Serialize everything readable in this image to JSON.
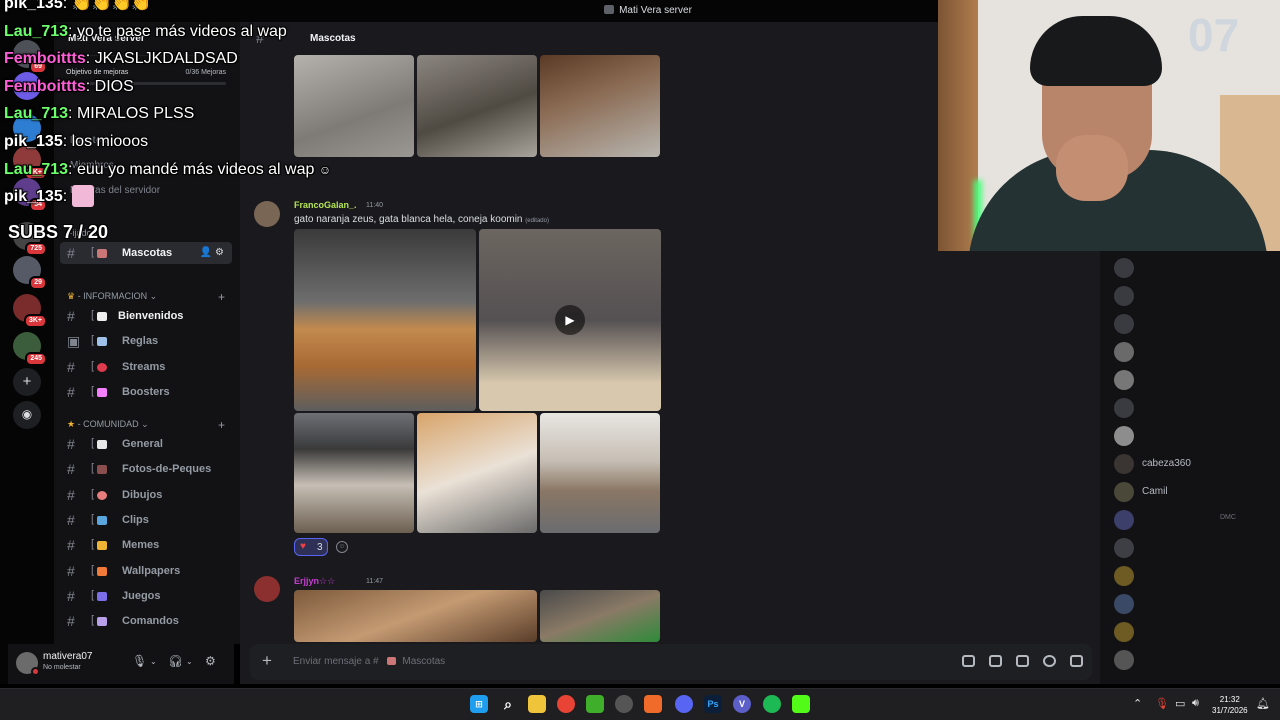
{
  "window": {
    "title": "Mati Vera server"
  },
  "servers": {
    "badges": [
      "69",
      "6K+",
      "34",
      "725",
      "29",
      "3K+",
      "245"
    ],
    "add_icon": "plus-icon",
    "explore_icon": "compass-icon"
  },
  "sidebar": {
    "server_name": "Mati Vera server",
    "boost_goal_label": "Objetivo de mejoras",
    "boost_goal_value": "0/36 Mejoras",
    "boost_progress": 0,
    "links": [
      "Eventos",
      "Miembros",
      "Mejoras del servidor"
    ],
    "categories": {
      "fixed": "Fijados",
      "info": "INFORMACION",
      "community": "COMUNIDAD"
    },
    "pinned_channels": [
      {
        "label": "Mascotas",
        "emoji_color": "#c77",
        "active": true
      }
    ],
    "info_channels": [
      {
        "label": "Bienvenidos",
        "emoji_color": "#eee",
        "white": true
      },
      {
        "label": "Reglas",
        "emoji_color": "#9fc0e8"
      },
      {
        "label": "Streams",
        "emoji_color": "#e03a4f"
      },
      {
        "label": "Boosters",
        "emoji_color": "#f47fff"
      }
    ],
    "community_channels": [
      {
        "label": "General",
        "emoji_color": "#e8e8e8"
      },
      {
        "label": "Fotos-de-Peques",
        "emoji_color": "#8a4e4e"
      },
      {
        "label": "Dibujos",
        "emoji_color": "#e67c7c"
      },
      {
        "label": "Clips",
        "emoji_color": "#5aa7e0"
      },
      {
        "label": "Memes",
        "emoji_color": "#f0b232"
      },
      {
        "label": "Wallpapers",
        "emoji_color": "#f07a3a"
      },
      {
        "label": "Juegos",
        "emoji_color": "#7b6ee8"
      },
      {
        "label": "Comandos",
        "emoji_color": "#b9a0e8"
      }
    ]
  },
  "user": {
    "name": "mativera07",
    "status": "No molestar"
  },
  "channel": {
    "name": "Mascotas",
    "composer_placeholder": "Enviar mensaje a # ",
    "composer_channel": "Mascotas"
  },
  "messages": [
    {
      "author": "FrancoGalan_.",
      "author_color": "#b5e655",
      "time": "11:40",
      "text": "gato naranja zeus, gata blanca hela, coneja koomin",
      "edited": "(editado)",
      "reaction_count": "3"
    },
    {
      "author": "Erjjyn☆☆",
      "author_color": "#c43dd1",
      "time": "11:47"
    }
  ],
  "members": [
    {
      "name": "",
      "lit": false
    },
    {
      "name": "",
      "lit": false
    },
    {
      "name": "",
      "lit": false
    },
    {
      "name": "",
      "lit": false
    },
    {
      "name": "",
      "lit": false
    },
    {
      "name": "",
      "lit": false
    },
    {
      "name": "",
      "lit": false
    },
    {
      "name": "cabeza360",
      "lit": true
    },
    {
      "name": "Camil",
      "lit": true
    }
  ],
  "member_tag": "DMC",
  "overlay": {
    "chat": [
      {
        "user": "pik_135",
        "color": "#ffffff",
        "text": ""
      },
      {
        "user": "Lau_713",
        "color": "#6bff6b",
        "text": "yo te pase más videos al wap"
      },
      {
        "user": "Femboittts",
        "color": "#ff5ed7",
        "text": "JKASLJKDALDSAD"
      },
      {
        "user": "Femboittts",
        "color": "#ff5ed7",
        "text": "DIOS"
      },
      {
        "user": "Lau_713",
        "color": "#6bff6b",
        "text": "MIRALOS PLSS"
      },
      {
        "user": "pik_135",
        "color": "#ffffff",
        "text": "los miooos"
      },
      {
        "user": "Lau_713",
        "color": "#6bff6b",
        "text": "euu yo mandé más videos al wap"
      },
      {
        "user": "pik_135",
        "color": "#ffffff",
        "text": ""
      }
    ],
    "subs": "SUBS 7 / 20"
  },
  "taskbar": {
    "time": "21:32",
    "date": "31/7/2026"
  },
  "colors": {
    "discord_bg": "#1a1a1e",
    "sidebar_bg": "#121214",
    "accent": "#5865f2",
    "dnd": "#da373c"
  }
}
